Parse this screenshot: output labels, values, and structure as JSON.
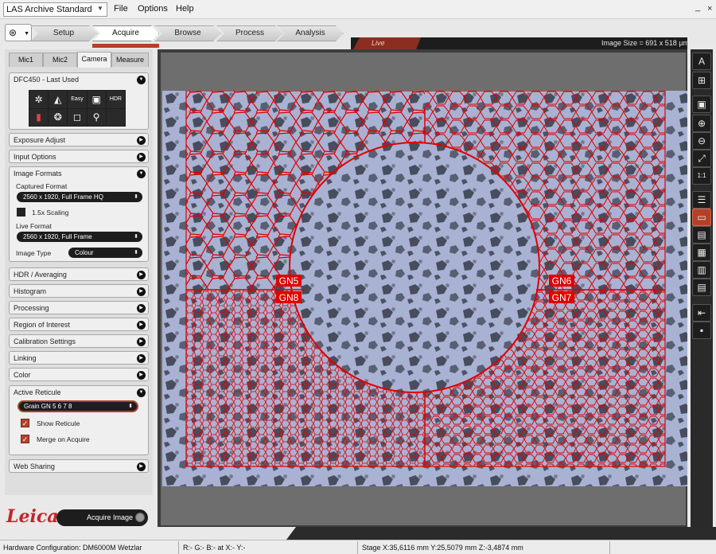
{
  "menubar": {
    "app_name": "LAS Archive Standard",
    "items": [
      "File",
      "Options",
      "Help"
    ]
  },
  "workflow_tabs": [
    "Setup",
    "Acquire",
    "Browse",
    "Process",
    "Analysis"
  ],
  "active_workflow_tab": "Acquire",
  "left_panel": {
    "subtabs": [
      "Mic1",
      "Mic2",
      "Camera",
      "Measure"
    ],
    "active_subtab": "Camera",
    "camera_section": "DFC450 - Last Used",
    "camera_icons": [
      "aperture-icon",
      "exposure-icon",
      "easy-icon",
      "white-balance-icon",
      "hdr-icon",
      "color-icon",
      "settings-icon",
      "frame-icon",
      "profile-icon"
    ],
    "easy_label": "Easy",
    "hdr_label": "HDR",
    "sections": {
      "exposure_adjust": "Exposure Adjust",
      "input_options": "Input Options",
      "image_formats": "Image Formats",
      "hdr_averaging": "HDR / Averaging",
      "histogram": "Histogram",
      "processing": "Processing",
      "region_of_interest": "Region of Interest",
      "calibration_settings": "Calibration Settings",
      "linking": "Linking",
      "color": "Color",
      "active_reticule": "Active Reticule",
      "web_sharing": "Web Sharing"
    },
    "image_formats": {
      "captured_format_label": "Captured Format",
      "captured_format_value": "2560 x 1920,   Full Frame HQ",
      "scaling_label": "1.5x Scaling",
      "live_format_label": "Live Format",
      "live_format_value": "2560 x 1920,   Full Frame",
      "image_type_label": "Image Type",
      "image_type_value": "Colour"
    },
    "active_reticule": {
      "value": "Grain GN 5 6 7 8",
      "show_reticule": "Show Reticule",
      "merge_on_acquire": "Merge on Acquire"
    }
  },
  "acquire_button": "Acquire Image",
  "brand": "Leica",
  "viewer": {
    "mode": "Live",
    "image_size": "Image Size = 691 x 518 µm",
    "reticule_labels": [
      "GN5",
      "GN6",
      "GN7",
      "GN8"
    ]
  },
  "right_toolbar": [
    "text-tool-icon",
    "tree-icon",
    "snapshot-icon",
    "zoom-in-icon",
    "zoom-out-icon",
    "fit-icon",
    "one-to-one-icon",
    "document-icon",
    "frame-icon",
    "table-icon",
    "grid-icon",
    "report-icon",
    "report-list-icon",
    "export-icon",
    "save-icon"
  ],
  "status_bar": {
    "hardware": "Hardware Configuration: DM6000M Wetzlar",
    "rgb": "R:-  G:-  B:-  at  X:-  Y:-",
    "stage": "Stage X:35,6116 mm  Y:25,5079 mm  Z:-3,4874 mm"
  },
  "colors": {
    "accent": "#b3412a",
    "reticule": "#e00000",
    "specimen_bg": "#a9b2d2",
    "brand_red": "#c4252a"
  }
}
